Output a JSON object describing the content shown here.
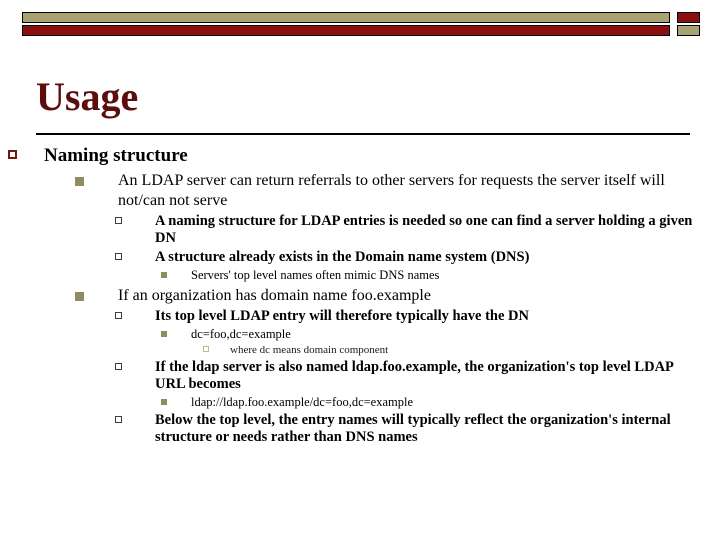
{
  "header": {
    "banner_top_bar_color": "#a9a373",
    "banner_top_square_color": "#8b0f0f",
    "banner_bottom_bar_color": "#8b0f0f",
    "banner_bottom_square_color": "#a9a373"
  },
  "slide": {
    "title": "Usage",
    "title_color": "#5c0d0d",
    "outline": [
      {
        "level": 1,
        "bullet": "hollow-square",
        "bullet_color": "#7b1313",
        "text": "Naming structure"
      },
      {
        "level": 2,
        "bullet": "filled-square",
        "bullet_color": "#8f8c5e",
        "text": "An LDAP server can return referrals to other servers for requests the server itself will not/can not serve"
      },
      {
        "level": 3,
        "bullet": "hollow-square",
        "bullet_color": "#3c3c3c",
        "text": "A naming structure for LDAP entries is needed so one can find a server holding a given DN"
      },
      {
        "level": 3,
        "bullet": "hollow-square",
        "bullet_color": "#3c3c3c",
        "text": "A structure already exists in the Domain name system (DNS)"
      },
      {
        "level": 4,
        "bullet": "filled-square",
        "bullet_color": "#8f8c5e",
        "text": "Servers' top level names often mimic DNS names"
      },
      {
        "level": 2,
        "bullet": "filled-square",
        "bullet_color": "#8f8c5e",
        "text": "If an organization has domain name foo.example"
      },
      {
        "level": 3,
        "bullet": "hollow-square",
        "bullet_color": "#3c3c3c",
        "text": "Its top level LDAP entry will therefore typically have the DN"
      },
      {
        "level": 4,
        "bullet": "filled-square",
        "bullet_color": "#8f8c5e",
        "text": "dc=foo,dc=example"
      },
      {
        "level": 5,
        "bullet": "hollow-square",
        "bullet_color": "#c2bb85",
        "text": "where dc means domain component"
      },
      {
        "level": 3,
        "bullet": "hollow-square",
        "bullet_color": "#3c3c3c",
        "text": "If the ldap server is also named ldap.foo.example, the organization's top level LDAP URL becomes"
      },
      {
        "level": 4,
        "bullet": "filled-square",
        "bullet_color": "#8f8c5e",
        "text": "ldap://ldap.foo.example/dc=foo,dc=example"
      },
      {
        "level": 3,
        "bullet": "hollow-square",
        "bullet_color": "#3c3c3c",
        "text": "Below the top level, the entry names will typically reflect the organization's internal structure or needs rather than DNS names"
      }
    ]
  }
}
